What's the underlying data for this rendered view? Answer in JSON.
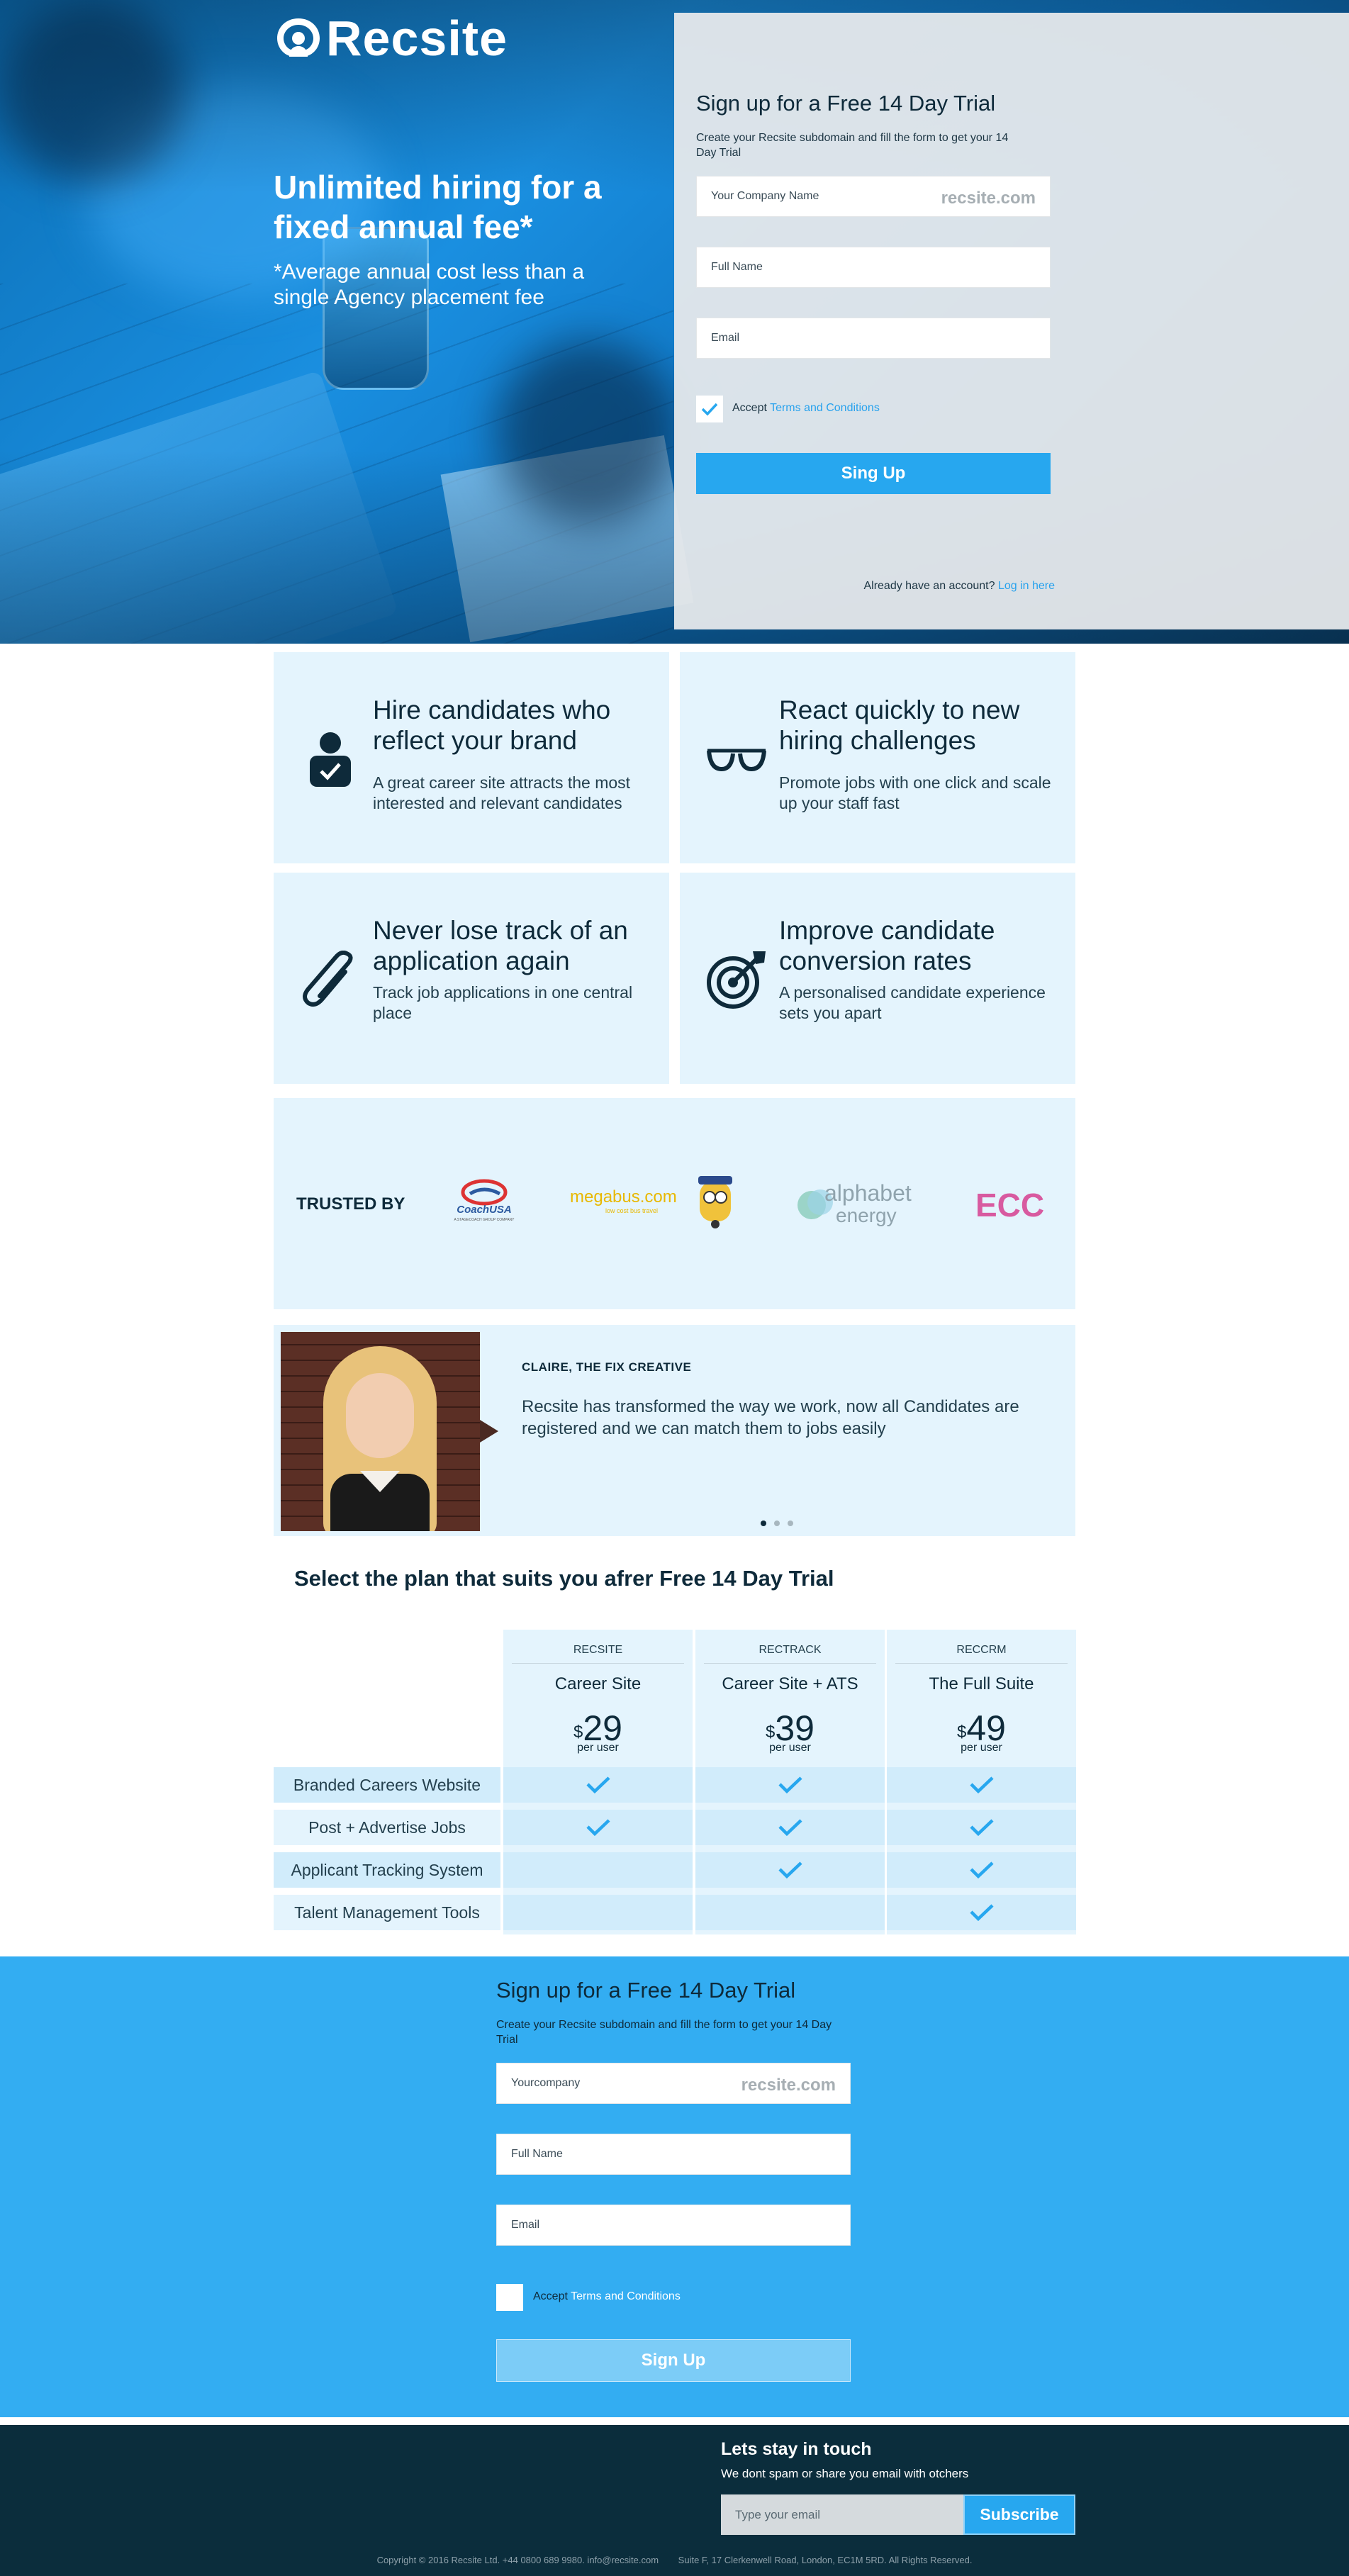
{
  "brand": {
    "name": "Recsite"
  },
  "hero": {
    "headline": "Unlimited hiring for a fixed annual fee*",
    "subline": "*Average annual cost less than a single Agency placement fee"
  },
  "signup_top": {
    "title": "Sign up for a Free 14 Day Trial",
    "description": "Create your Recsite subdomain and fill the form to get your 14 Day Trial",
    "company_placeholder": "Your Company Name",
    "domain_suffix": "recsite.com",
    "fullname_placeholder": "Full Name",
    "email_placeholder": "Email",
    "accept_text": "Accept",
    "terms_link": "Terms and Conditions",
    "checkbox_checked": true,
    "button": "Sing Up",
    "login_prompt": "Already have an account?",
    "login_link": "Log in here"
  },
  "features": [
    {
      "icon": "user-check-icon",
      "title": "Hire candidates who reflect your brand",
      "text": "A great career site attracts the most interested and relevant candidates"
    },
    {
      "icon": "glasses-icon",
      "title": "React quickly to new hiring challenges",
      "text": "Promote jobs with one click and scale up your staff fast"
    },
    {
      "icon": "paperclip-icon",
      "title": "Never lose track of an application again",
      "text": "Track job applications in one central place"
    },
    {
      "icon": "target-icon",
      "title": "Improve candidate conversion rates",
      "text": "A personalised candidate experience sets you apart"
    }
  ],
  "trusted": {
    "label": "TRUSTED BY",
    "logos": [
      {
        "name": "CoachUSA",
        "tagline": "A STAGECOACH GROUP COMPANY"
      },
      {
        "name": "megabus.com",
        "tagline": "low cost bus travel"
      },
      {
        "name": "alphabet",
        "name2": "energy"
      },
      {
        "name": "ECC"
      }
    ]
  },
  "testimonial": {
    "author": "CLAIRE, THE FIX CREATIVE",
    "quote": "Recsite has transformed the way we work, now all Candidates are registered and we can match them to jobs easily",
    "slides": 3,
    "active_slide": 1
  },
  "plans": {
    "title": "Select the plan that suits you afrer Free 14 Day Trial",
    "columns": [
      {
        "code": "RECSITE",
        "name": "Career Site",
        "currency": "$",
        "price": "29",
        "per": "per user"
      },
      {
        "code": "RECTRACK",
        "name": "Career Site + ATS",
        "currency": "$",
        "price": "39",
        "per": "per user"
      },
      {
        "code": "RECCRM",
        "name": "The Full Suite",
        "currency": "$",
        "price": "49",
        "per": "per user"
      }
    ],
    "features": [
      {
        "label": "Branded Careers Website",
        "included": [
          true,
          true,
          true
        ]
      },
      {
        "label": "Post + Advertise Jobs",
        "included": [
          true,
          true,
          true
        ]
      },
      {
        "label": "Applicant Tracking System",
        "included": [
          false,
          true,
          true
        ]
      },
      {
        "label": "Talent Management Tools",
        "included": [
          false,
          false,
          true
        ]
      }
    ]
  },
  "signup_bottom": {
    "title": "Sign up for a Free 14 Day Trial",
    "description": "Create your Recsite subdomain and fill the form to get your 14 Day Trial",
    "company_placeholder": "Yourcompany",
    "domain_suffix": "recsite.com",
    "fullname_placeholder": "Full Name",
    "email_placeholder": "Email",
    "accept_text": "Accept",
    "terms_link": "Terms and Conditions",
    "checkbox_checked": false,
    "button": "Sign Up"
  },
  "footer": {
    "title": "Lets stay in touch",
    "subtitle": "We dont spam or share you email with otchers",
    "email_placeholder": "Type your email",
    "button": "Subscribe",
    "copyright": "Copyright © 2016 Recsite Ltd. +44 0800 689 9980. info@recsite.com",
    "address": "Suite F, 17 Clerkenwell Road, London, EC1M 5RD. All Rights Reserved."
  },
  "colors": {
    "accent": "#27a7ef",
    "dark": "#0b2d3c",
    "light_panel": "#e4f4fd",
    "check": "#27a7ef"
  }
}
